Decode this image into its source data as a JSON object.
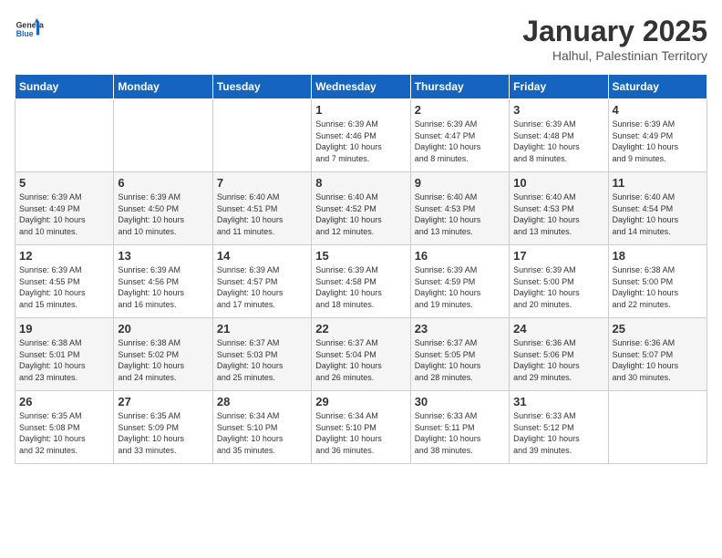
{
  "header": {
    "logo_general": "General",
    "logo_blue": "Blue",
    "title": "January 2025",
    "subtitle": "Halhul, Palestinian Territory"
  },
  "days_of_week": [
    "Sunday",
    "Monday",
    "Tuesday",
    "Wednesday",
    "Thursday",
    "Friday",
    "Saturday"
  ],
  "weeks": [
    [
      {
        "num": "",
        "info": ""
      },
      {
        "num": "",
        "info": ""
      },
      {
        "num": "",
        "info": ""
      },
      {
        "num": "1",
        "info": "Sunrise: 6:39 AM\nSunset: 4:46 PM\nDaylight: 10 hours\nand 7 minutes."
      },
      {
        "num": "2",
        "info": "Sunrise: 6:39 AM\nSunset: 4:47 PM\nDaylight: 10 hours\nand 8 minutes."
      },
      {
        "num": "3",
        "info": "Sunrise: 6:39 AM\nSunset: 4:48 PM\nDaylight: 10 hours\nand 8 minutes."
      },
      {
        "num": "4",
        "info": "Sunrise: 6:39 AM\nSunset: 4:49 PM\nDaylight: 10 hours\nand 9 minutes."
      }
    ],
    [
      {
        "num": "5",
        "info": "Sunrise: 6:39 AM\nSunset: 4:49 PM\nDaylight: 10 hours\nand 10 minutes."
      },
      {
        "num": "6",
        "info": "Sunrise: 6:39 AM\nSunset: 4:50 PM\nDaylight: 10 hours\nand 10 minutes."
      },
      {
        "num": "7",
        "info": "Sunrise: 6:40 AM\nSunset: 4:51 PM\nDaylight: 10 hours\nand 11 minutes."
      },
      {
        "num": "8",
        "info": "Sunrise: 6:40 AM\nSunset: 4:52 PM\nDaylight: 10 hours\nand 12 minutes."
      },
      {
        "num": "9",
        "info": "Sunrise: 6:40 AM\nSunset: 4:53 PM\nDaylight: 10 hours\nand 13 minutes."
      },
      {
        "num": "10",
        "info": "Sunrise: 6:40 AM\nSunset: 4:53 PM\nDaylight: 10 hours\nand 13 minutes."
      },
      {
        "num": "11",
        "info": "Sunrise: 6:40 AM\nSunset: 4:54 PM\nDaylight: 10 hours\nand 14 minutes."
      }
    ],
    [
      {
        "num": "12",
        "info": "Sunrise: 6:39 AM\nSunset: 4:55 PM\nDaylight: 10 hours\nand 15 minutes."
      },
      {
        "num": "13",
        "info": "Sunrise: 6:39 AM\nSunset: 4:56 PM\nDaylight: 10 hours\nand 16 minutes."
      },
      {
        "num": "14",
        "info": "Sunrise: 6:39 AM\nSunset: 4:57 PM\nDaylight: 10 hours\nand 17 minutes."
      },
      {
        "num": "15",
        "info": "Sunrise: 6:39 AM\nSunset: 4:58 PM\nDaylight: 10 hours\nand 18 minutes."
      },
      {
        "num": "16",
        "info": "Sunrise: 6:39 AM\nSunset: 4:59 PM\nDaylight: 10 hours\nand 19 minutes."
      },
      {
        "num": "17",
        "info": "Sunrise: 6:39 AM\nSunset: 5:00 PM\nDaylight: 10 hours\nand 20 minutes."
      },
      {
        "num": "18",
        "info": "Sunrise: 6:38 AM\nSunset: 5:00 PM\nDaylight: 10 hours\nand 22 minutes."
      }
    ],
    [
      {
        "num": "19",
        "info": "Sunrise: 6:38 AM\nSunset: 5:01 PM\nDaylight: 10 hours\nand 23 minutes."
      },
      {
        "num": "20",
        "info": "Sunrise: 6:38 AM\nSunset: 5:02 PM\nDaylight: 10 hours\nand 24 minutes."
      },
      {
        "num": "21",
        "info": "Sunrise: 6:37 AM\nSunset: 5:03 PM\nDaylight: 10 hours\nand 25 minutes."
      },
      {
        "num": "22",
        "info": "Sunrise: 6:37 AM\nSunset: 5:04 PM\nDaylight: 10 hours\nand 26 minutes."
      },
      {
        "num": "23",
        "info": "Sunrise: 6:37 AM\nSunset: 5:05 PM\nDaylight: 10 hours\nand 28 minutes."
      },
      {
        "num": "24",
        "info": "Sunrise: 6:36 AM\nSunset: 5:06 PM\nDaylight: 10 hours\nand 29 minutes."
      },
      {
        "num": "25",
        "info": "Sunrise: 6:36 AM\nSunset: 5:07 PM\nDaylight: 10 hours\nand 30 minutes."
      }
    ],
    [
      {
        "num": "26",
        "info": "Sunrise: 6:35 AM\nSunset: 5:08 PM\nDaylight: 10 hours\nand 32 minutes."
      },
      {
        "num": "27",
        "info": "Sunrise: 6:35 AM\nSunset: 5:09 PM\nDaylight: 10 hours\nand 33 minutes."
      },
      {
        "num": "28",
        "info": "Sunrise: 6:34 AM\nSunset: 5:10 PM\nDaylight: 10 hours\nand 35 minutes."
      },
      {
        "num": "29",
        "info": "Sunrise: 6:34 AM\nSunset: 5:10 PM\nDaylight: 10 hours\nand 36 minutes."
      },
      {
        "num": "30",
        "info": "Sunrise: 6:33 AM\nSunset: 5:11 PM\nDaylight: 10 hours\nand 38 minutes."
      },
      {
        "num": "31",
        "info": "Sunrise: 6:33 AM\nSunset: 5:12 PM\nDaylight: 10 hours\nand 39 minutes."
      },
      {
        "num": "",
        "info": ""
      }
    ]
  ]
}
